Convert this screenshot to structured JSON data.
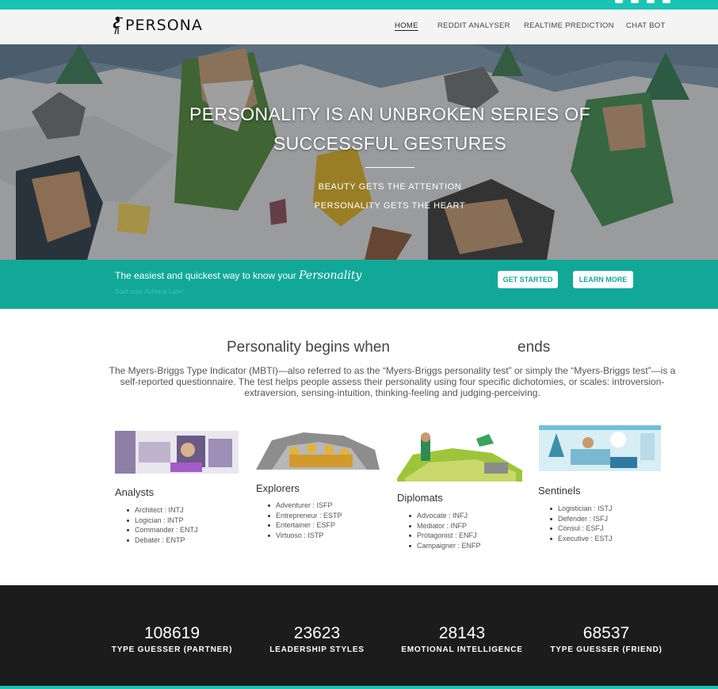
{
  "brand": {
    "logo_text": "PERSONA"
  },
  "nav": {
    "items": [
      {
        "label": "HOME"
      },
      {
        "label": "REDDIT ANALYSER"
      },
      {
        "label": "REALTIME PREDICTION"
      },
      {
        "label": "CHAT BOT"
      }
    ],
    "active": "HOME"
  },
  "hero": {
    "title_line1": "PERSONALITY IS AN UNBROKEN SERIES OF",
    "title_line2": "SUCCESSFUL GESTURES",
    "sub1": "BEAUTY GETS THE ATTENTION",
    "sub2": "PERSONALITY GETS THE HEART"
  },
  "cta": {
    "text": "The easiest and quickest way to know your",
    "accent": "Personality",
    "small": "Start now, Achieve Later",
    "get_started": "GET STARTED",
    "learn_more": "LEARN MORE"
  },
  "intro": {
    "title_part1": "Personality begins when",
    "title_part2": "ends",
    "description": "The Myers-Briggs Type Indicator (MBTI)—also referred to as the “Myers-Briggs personality test” or simply the “Myers-Briggs test”—is a self-reported questionnaire. The test helps people assess their personality using four specific dichotomies, or scales: introversion-extraversion, sensing-intuition, thinking-feeling and judging-perceiving."
  },
  "groups": [
    {
      "title": "Analysts",
      "items": [
        "Architect : INTJ",
        "Logician : INTP",
        "Commander : ENTJ",
        "Debater : ENTP"
      ]
    },
    {
      "title": "Explorers",
      "items": [
        "Adventurer : ISFP",
        "Entrepreneur : ESTP",
        "Entertainer : ESFP",
        "Virtuoso : ISTP"
      ]
    },
    {
      "title": "Diplomats",
      "items": [
        "Advocate : INFJ",
        "Mediator : INFP",
        "Protagonist : ENFJ",
        "Campaigner : ENFP"
      ]
    },
    {
      "title": "Sentinels",
      "items": [
        "Logistician : ISTJ",
        "Defender : ISFJ",
        "Consul : ESFJ",
        "Executive : ESTJ"
      ]
    }
  ],
  "stats": [
    {
      "value": "108619",
      "label": "TYPE GUESSER (PARTNER)"
    },
    {
      "value": "23623",
      "label": "LEADERSHIP STYLES"
    },
    {
      "value": "28143",
      "label": "EMOTIONAL INTELLIGENCE"
    },
    {
      "value": "68537",
      "label": "TYPE GUESSER (FRIEND)"
    }
  ],
  "colors": {
    "teal": "#19c4b2",
    "cta_teal": "#11a898",
    "dark": "#1c1c1c"
  },
  "icons": [
    "linkedin-icon",
    "twitter-icon",
    "facebook-icon",
    "instagram-icon",
    "heron-logo-icon"
  ]
}
